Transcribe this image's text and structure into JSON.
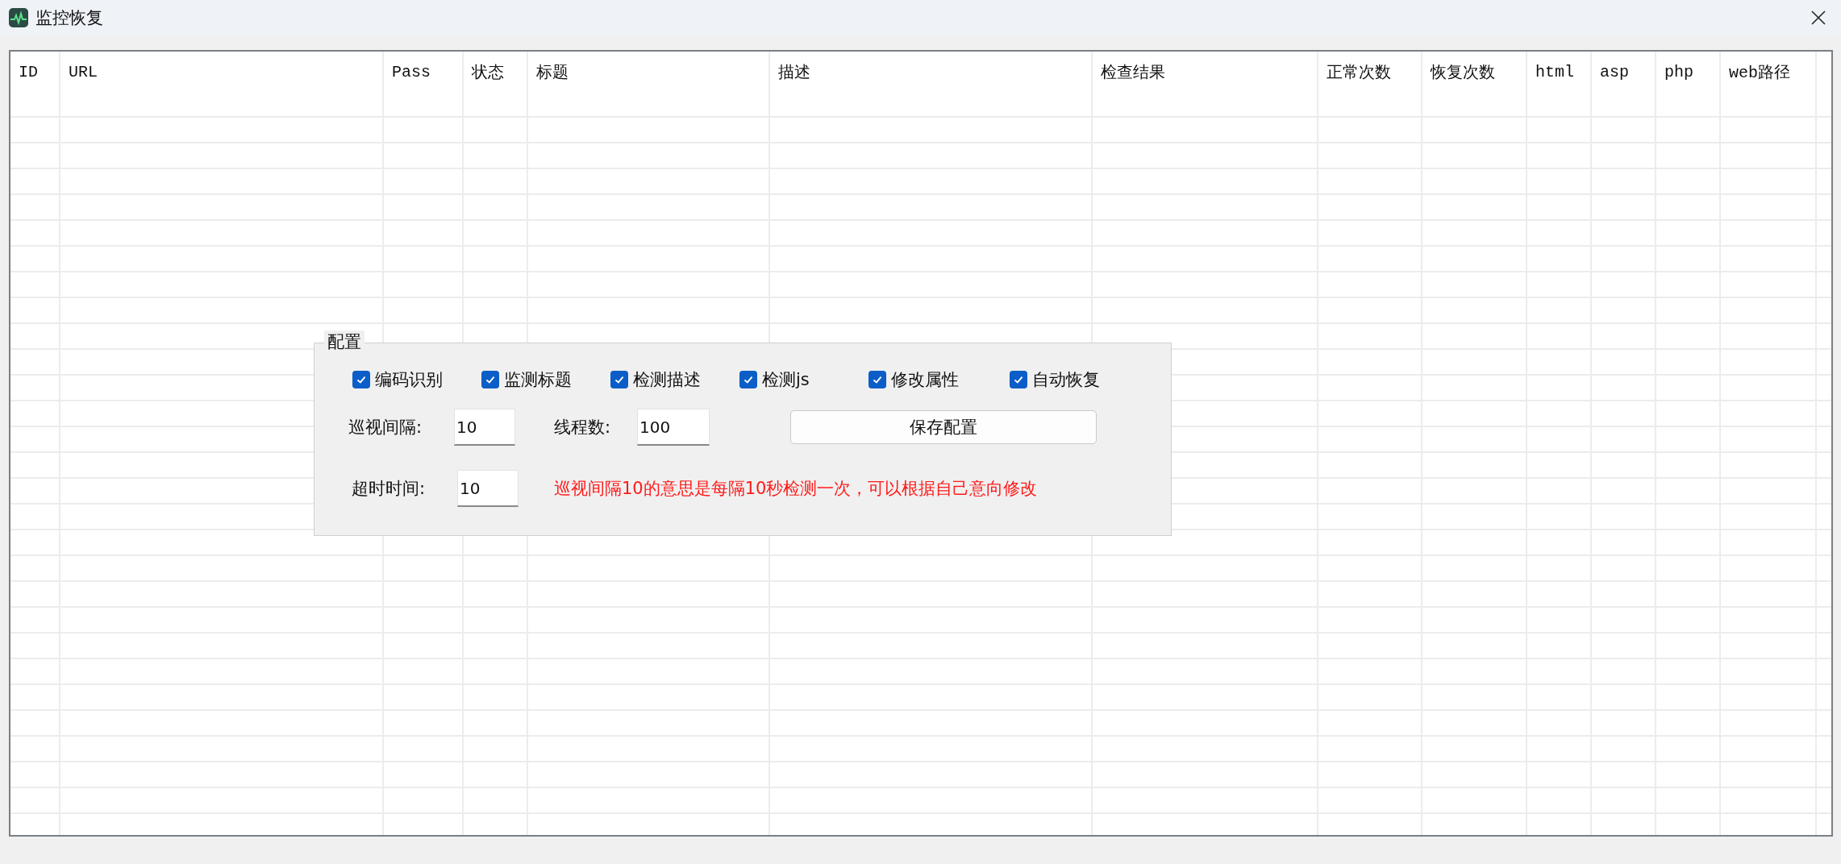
{
  "window": {
    "title": "监控恢复"
  },
  "table": {
    "columns": [
      "ID",
      "URL",
      "Pass",
      "状态",
      "标题",
      "描述",
      "检查结果",
      "正常次数",
      "恢复次数",
      "html",
      "asp",
      "php",
      "web路径"
    ]
  },
  "config": {
    "title": "配置",
    "checkboxes": [
      {
        "label": "编码识别",
        "checked": true
      },
      {
        "label": "监测标题",
        "checked": true
      },
      {
        "label": "检测描述",
        "checked": true
      },
      {
        "label": "检测js",
        "checked": true
      },
      {
        "label": "修改属性",
        "checked": true
      },
      {
        "label": "自动恢复",
        "checked": true
      }
    ],
    "interval": {
      "label": "巡视间隔:",
      "value": "10"
    },
    "threads": {
      "label": "线程数:",
      "value": "100"
    },
    "save_button": "保存配置",
    "timeout": {
      "label": "超时时间:",
      "value": "10"
    },
    "note": "巡视间隔10的意思是每隔10秒检测一次，可以根据自己意向修改"
  }
}
